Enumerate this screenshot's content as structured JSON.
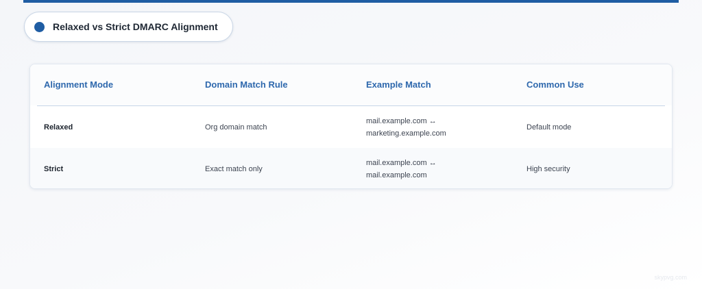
{
  "title": "Relaxed vs Strict DMARC Alignment",
  "colors": {
    "accent": "#1f5da3",
    "header_text": "#2e68ad",
    "body_text": "#3c4350"
  },
  "table": {
    "headers": [
      "Alignment Mode",
      "Domain Match Rule",
      "Example Match",
      "Common Use"
    ],
    "rows": [
      {
        "mode": "Relaxed",
        "rule": "Org domain match",
        "example_line1": "mail.example.com ↔",
        "example_line2": "marketing.example.com",
        "use": "Default mode"
      },
      {
        "mode": "Strict",
        "rule": "Exact match only",
        "example_line1": "mail.example.com ↔",
        "example_line2": "mail.example.com",
        "use": "High security"
      }
    ]
  },
  "watermark": "skypvg.com"
}
